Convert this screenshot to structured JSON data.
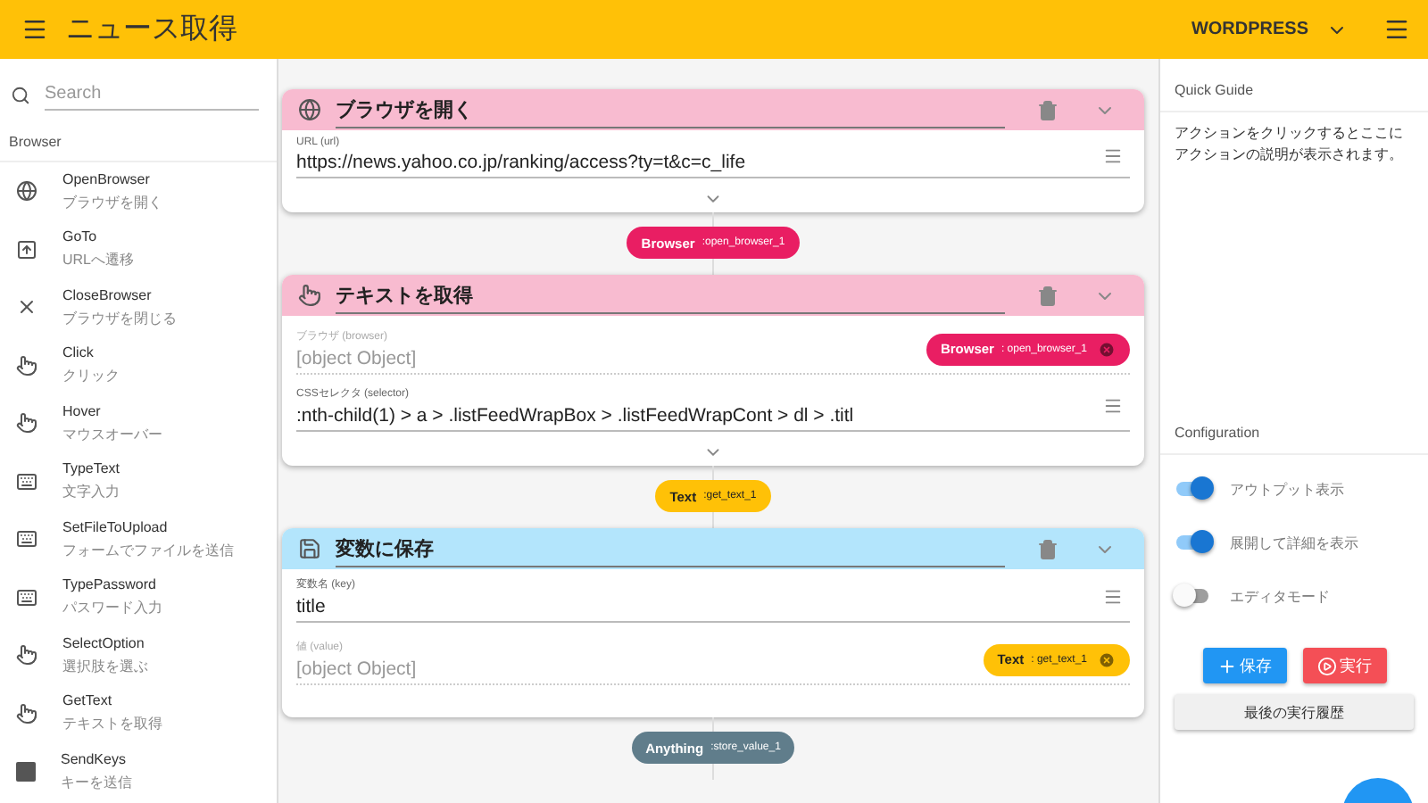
{
  "header": {
    "title": "ニュース取得",
    "project": "WORDPRESS"
  },
  "sidebar": {
    "search": {
      "placeholder": "Search"
    },
    "section": "Browser",
    "items": [
      {
        "name": "OpenBrowser",
        "description": "ブラウザを開く",
        "kind": "globe"
      },
      {
        "name": "GoTo",
        "description": "URLへ遷移",
        "kind": "navigate"
      },
      {
        "name": "CloseBrowser",
        "description": "ブラウザを閉じる",
        "kind": "close"
      },
      {
        "name": "Click",
        "description": "クリック",
        "kind": "pointer"
      },
      {
        "name": "Hover",
        "description": "マウスオーバー",
        "kind": "pointer"
      },
      {
        "name": "TypeText",
        "description": "文字入力",
        "kind": "keyboard"
      },
      {
        "name": "SetFileToUpload",
        "description": "フォームでファイルを送信",
        "kind": "keyboard"
      },
      {
        "name": "TypePassword",
        "description": "パスワード入力",
        "kind": "keyboard"
      },
      {
        "name": "SelectOption",
        "description": "選択肢を選ぶ",
        "kind": "pointer"
      },
      {
        "name": "GetText",
        "description": "テキストを取得",
        "kind": "pointer"
      },
      {
        "name": "SendKeys",
        "description": "キーを送信",
        "kind": "letter"
      }
    ]
  },
  "cards": [
    {
      "title": "ブラウザを開く",
      "kind": "globe",
      "color": "#f8bbd0",
      "expandable": true,
      "fields": [
        {
          "kind": "input",
          "label": "URL (url)",
          "value": "https://news.yahoo.co.jp/ranking/access?ty=t&c=c_life"
        }
      ],
      "output": {
        "type": "Browser",
        "name": ":open_browser_1",
        "color": "#e91e63"
      }
    },
    {
      "title": "テキストを取得",
      "kind": "pointer",
      "color": "#f8bbd0",
      "expandable": true,
      "fields": [
        {
          "kind": "reference",
          "label": "ブラウザ (browser)",
          "placeholder": "[object Object]",
          "chip": {
            "type": "Browser",
            "name": ": open_browser_1",
            "color": "#e91e63"
          }
        },
        {
          "kind": "input",
          "label": "CSSセレクタ (selector)",
          "value": ":nth-child(1) > a > .listFeedWrapBox > .listFeedWrapCont > dl > .titl"
        }
      ],
      "output": {
        "type": "Text",
        "name": ":get_text_1",
        "color": "#ffc107"
      }
    },
    {
      "title": "変数に保存",
      "kind": "save",
      "color": "#b3e5fc",
      "expandable": false,
      "fields": [
        {
          "kind": "input",
          "label": "変数名 (key)",
          "value": "title"
        },
        {
          "kind": "reference",
          "label": "値 (value)",
          "placeholder": "[object Object]",
          "chip": {
            "type": "Text",
            "name": ": get_text_1",
            "color": "#ffc107"
          }
        }
      ],
      "output": {
        "type": "Anything",
        "name": ":store_value_1",
        "color": "#607d8b"
      }
    }
  ],
  "guide": {
    "title": "Quick Guide",
    "text": "アクションをクリックするとここにアクションの説明が表示されます。"
  },
  "config": {
    "title": "Configuration",
    "toggles": [
      {
        "label": "アウトプット表示",
        "on": true
      },
      {
        "label": "展開して詳細を表示",
        "on": true
      },
      {
        "label": "エディタモード",
        "on": false
      }
    ],
    "buttons": [
      {
        "label": "保存",
        "kind": "save"
      },
      {
        "label": "実行",
        "kind": "run"
      }
    ],
    "history": "最後の実行履歴"
  }
}
